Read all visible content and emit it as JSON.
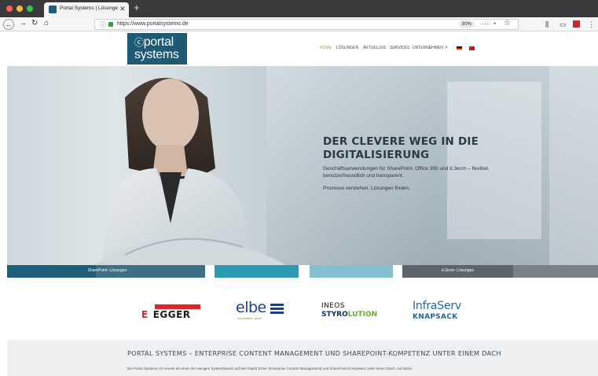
{
  "browser": {
    "tab_title": "Portal Systems | Lösungen für",
    "tab_close": "✕",
    "new_tab": "+",
    "url": "https://www.portalsystems.de",
    "zoom": "80%",
    "more": "···"
  },
  "site": {
    "logo_line1": "portal",
    "logo_line2": "systems",
    "menu": [
      "HOME",
      "LÖSUNGEN",
      "AKTUELLES",
      "SERVICES",
      "UNTERNEHMEN"
    ],
    "search_icon": "⌕"
  },
  "hero": {
    "title": "DER CLEVERE WEG IN DIE DIGITALISIERUNG",
    "subtitle": "Geschäftsanwendungen für SharePoint, Office 365 und d.3ecm – flexibel, benutzerfreundlich und transparent.",
    "tagline": "Prozesse verstehen. Lösungen finden."
  },
  "color_bar": [
    {
      "label": "SharePoint- Lösungen",
      "color": "#1d5f7a"
    },
    {
      "label": "",
      "color": "#2a9bb0"
    },
    {
      "label": "",
      "color": "#86bfcf"
    },
    {
      "label": "d.3ecm- Lösungen",
      "color": "#6c747a"
    }
  ],
  "partners": {
    "egger": {
      "e": "E",
      "name": "EGGER"
    },
    "elbe": {
      "word": "elbe",
      "sub": "werkstätten gmbh"
    },
    "ineos": {
      "line1": "INEOS",
      "line2a": "STYRO",
      "line2b": "LUTION"
    },
    "infraserv": {
      "line1": "InfraServ",
      "line2": "KNAPSACK"
    }
  },
  "section": {
    "title": "PORTAL SYSTEMS – ENTERPRISE CONTENT MANAGEMENT UND SHAREPOINT-KOMPETENZ UNTER EINEM DACH",
    "text": "Die Portal Systems AG vereint als eines der wenigen Systemhäuser auf dem Markt ECM- (Enterprise Content Management) und SharePoint-Kompetenz unter einem Dach. Auf Basis"
  },
  "colors": {
    "brand": "#1e5a73",
    "accent": "#c8923a"
  }
}
